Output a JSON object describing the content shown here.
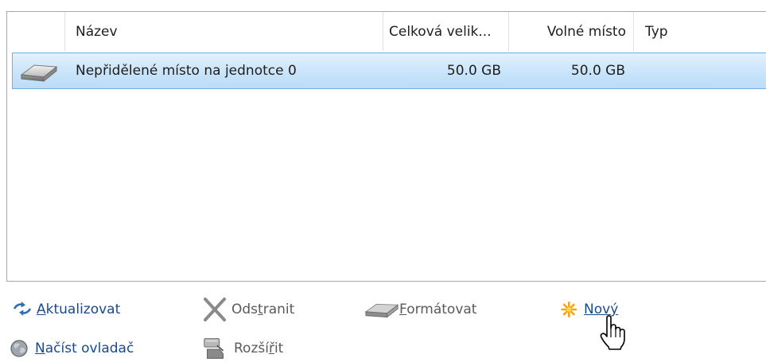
{
  "columns": {
    "name": "Název",
    "total_size": "Celková velik...",
    "free_space": "Volné místo",
    "type": "Typ"
  },
  "rows": [
    {
      "icon": "hard-drive-icon",
      "name": "Nepřidělené místo na jednotce 0",
      "total_size": "50.0 GB",
      "free_space": "50.0 GB",
      "type": "",
      "selected": true
    }
  ],
  "actions": {
    "refresh": {
      "pre": "",
      "key": "A",
      "post": "ktualizovat",
      "icon": "refresh-icon"
    },
    "delete": {
      "pre": "Ods",
      "key": "t",
      "post": "ranit",
      "icon": "delete-x-icon"
    },
    "format": {
      "pre": "",
      "key": "F",
      "post": "ormátovat",
      "icon": "format-disk-icon"
    },
    "new": {
      "pre": "Nov",
      "key": "ý",
      "post": "",
      "icon": "new-sparkle-icon"
    },
    "load_driver": {
      "pre": "",
      "key": "N",
      "post": "ačíst ovladač",
      "icon": "load-driver-icon"
    },
    "extend": {
      "pre": "Rozší",
      "key": "ř",
      "post": "it",
      "icon": "extend-disk-icon"
    }
  },
  "colors": {
    "selection": "#c9e4fa",
    "selection_border": "#6fb0e4",
    "link": "#1a4a8a",
    "disabled": "#5a5a5a"
  }
}
